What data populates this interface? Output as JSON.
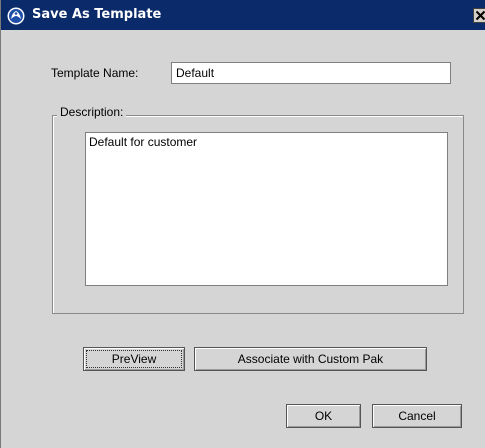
{
  "dialog": {
    "title": "Save As Template",
    "title_icon": "app-logo-icon",
    "close_icon": "close-icon"
  },
  "form": {
    "template_name_label": "Template Name:",
    "template_name_value": "Default",
    "description_label": "Description:",
    "description_value": "Default for customer"
  },
  "actions": {
    "preview_label": "PreView",
    "associate_label": "Associate with Custom Pak",
    "ok_label": "OK",
    "cancel_label": "Cancel"
  },
  "colors": {
    "titlebar": "#0a2a6a",
    "dialog_background": "#d5d5d5",
    "field_background": "#ffffff"
  }
}
